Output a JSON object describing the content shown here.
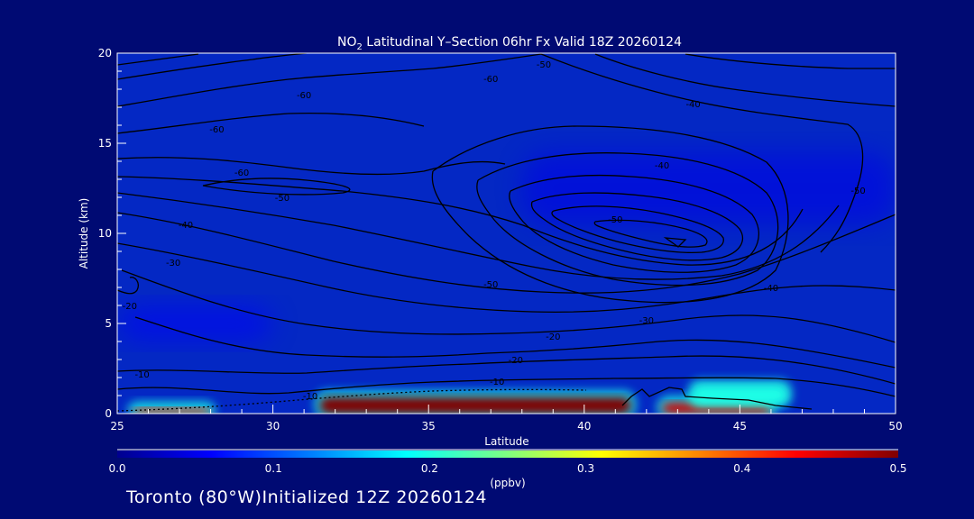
{
  "chart_data": {
    "type": "heatmap",
    "title": {
      "prefix": "NO",
      "subscript": "2",
      "text": " Latitudinal Y–Section 06hr  Fx Valid 18Z 20260124"
    },
    "xlabel": "Latitude",
    "ylabel": "Altitude (km)",
    "xlim": [
      25,
      50
    ],
    "ylim": [
      0,
      20
    ],
    "x_ticks": [
      25,
      30,
      35,
      40,
      45,
      50
    ],
    "y_ticks": [
      0,
      5,
      10,
      15,
      20
    ],
    "grid": false,
    "colorbar": {
      "label": "(ppbv)",
      "range": [
        0.0,
        0.5
      ],
      "ticks": [
        "0.0",
        "0.1",
        "0.2",
        "0.3",
        "0.4",
        "0.5"
      ],
      "colormap": [
        "#00008f",
        "#0000ff",
        "#0080ff",
        "#00ffff",
        "#80ff80",
        "#ffff00",
        "#ff8000",
        "#ff0000",
        "#800000"
      ]
    },
    "concentration_regions": [
      {
        "lat_range": [
          25.5,
          28.0
        ],
        "alt_range": [
          0.0,
          0.3
        ],
        "value": 0.42
      },
      {
        "lat_range": [
          31.5,
          41.5
        ],
        "alt_range": [
          0.0,
          0.9
        ],
        "value": 0.5
      },
      {
        "lat_range": [
          42.5,
          46.0
        ],
        "alt_range": [
          0.0,
          0.6
        ],
        "value": 0.46
      },
      {
        "lat_range": [
          43.5,
          46.5
        ],
        "alt_range": [
          0.6,
          1.5
        ],
        "value": 0.2
      },
      {
        "lat_range": [
          25.0,
          30.0
        ],
        "alt_range": [
          4.0,
          6.0
        ],
        "value": 0.06
      },
      {
        "lat_range": [
          38.0,
          50.0
        ],
        "alt_range": [
          10.5,
          14.5
        ],
        "value": 0.05
      }
    ],
    "contour_labels": [
      {
        "text": "-10",
        "lat": 25.8,
        "alt": 2.0
      },
      {
        "text": "-10",
        "lat": 31.2,
        "alt": 0.8
      },
      {
        "text": "-20",
        "lat": 25.4,
        "alt": 5.8
      },
      {
        "text": "-30",
        "lat": 26.8,
        "alt": 8.2
      },
      {
        "text": "-40",
        "lat": 27.2,
        "alt": 10.3
      },
      {
        "text": "-50",
        "lat": 30.3,
        "alt": 11.8
      },
      {
        "text": "-60",
        "lat": 29.0,
        "alt": 13.2
      },
      {
        "text": "-60",
        "lat": 28.2,
        "alt": 15.6
      },
      {
        "text": "-60",
        "lat": 31.0,
        "alt": 17.5
      },
      {
        "text": "-60",
        "lat": 37.0,
        "alt": 18.4
      },
      {
        "text": "-50",
        "lat": 38.7,
        "alt": 19.2
      },
      {
        "text": "-40",
        "lat": 43.5,
        "alt": 17.0
      },
      {
        "text": "-40",
        "lat": 42.5,
        "alt": 13.6
      },
      {
        "text": "-50",
        "lat": 41.0,
        "alt": 10.6
      },
      {
        "text": "-50",
        "lat": 37.0,
        "alt": 7.0
      },
      {
        "text": "-40",
        "lat": 46.0,
        "alt": 6.8
      },
      {
        "text": "-30",
        "lat": 42.0,
        "alt": 5.0
      },
      {
        "text": "-20",
        "lat": 39.0,
        "alt": 4.1
      },
      {
        "text": "-20",
        "lat": 37.8,
        "alt": 2.8
      },
      {
        "text": "-10",
        "lat": 37.2,
        "alt": 1.6
      },
      {
        "text": "-50",
        "lat": 48.8,
        "alt": 12.2
      }
    ],
    "annotations": [
      {
        "text": "-50",
        "lat": 36.5,
        "alt": 18.8
      }
    ]
  },
  "footer": {
    "text": "Toronto (80°W)Initialized 12Z 20260124"
  }
}
